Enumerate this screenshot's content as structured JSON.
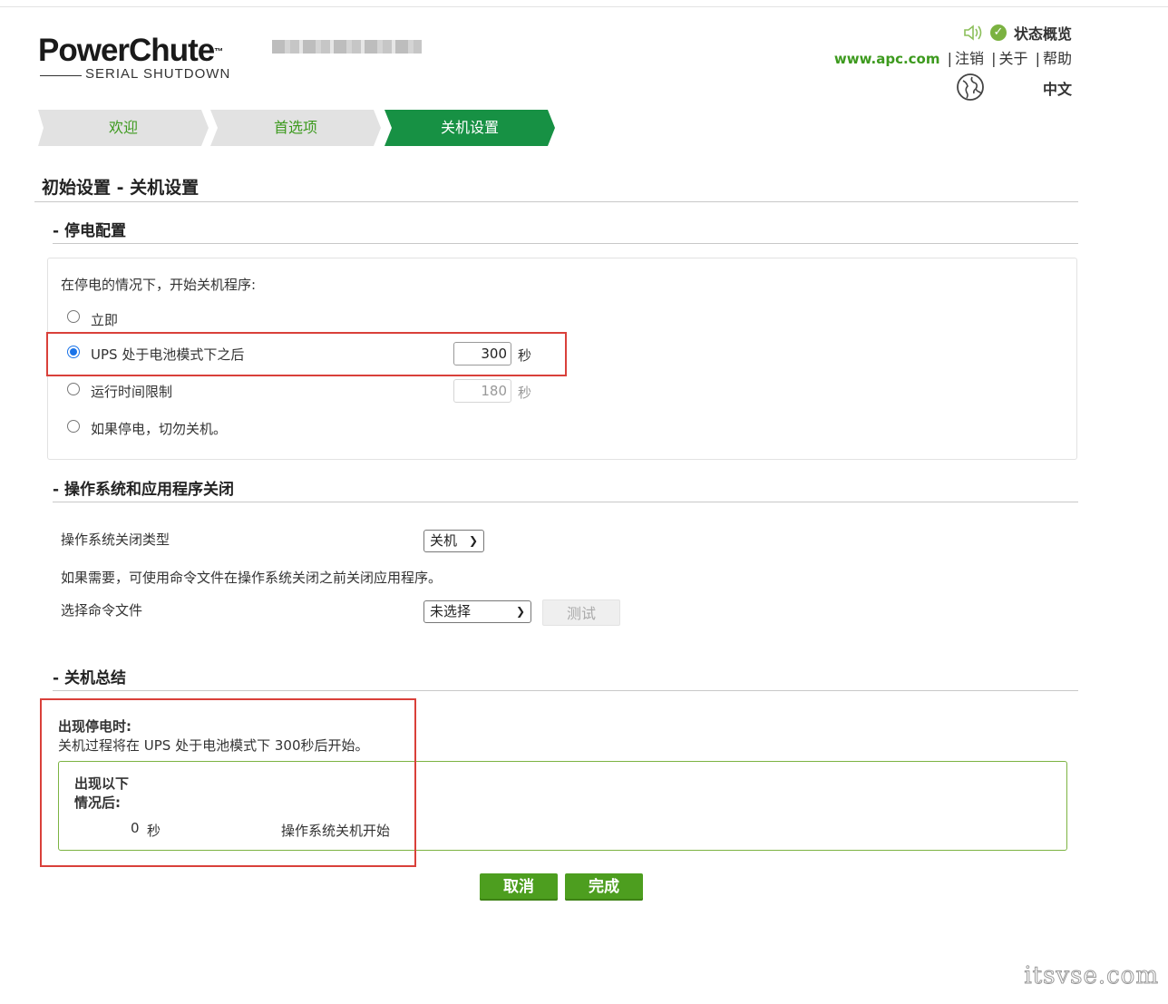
{
  "logo": {
    "main": "PowerChute",
    "tm": "™",
    "sub": "SERIAL SHUTDOWN"
  },
  "header": {
    "status_label": "状态概览",
    "apc_link": "www.apc.com",
    "logout": "注销",
    "about": "关于",
    "help": "帮助",
    "language": "中文",
    "separator": "|"
  },
  "steps": [
    "欢迎",
    "首选项",
    "关机设置"
  ],
  "page_title": "初始设置 - 关机设置",
  "power_section": {
    "heading": "- 停电配置",
    "prompt": "在停电的情况下，开始关机程序:",
    "options": [
      {
        "label": "立即",
        "checked": false
      },
      {
        "label": "UPS 处于电池模式下之后",
        "checked": true,
        "value": "300",
        "unit": "秒"
      },
      {
        "label": "运行时间限制",
        "checked": false,
        "value": "180",
        "unit": "秒"
      },
      {
        "label": "如果停电，切勿关机。",
        "checked": false
      }
    ]
  },
  "os_section": {
    "heading": "- 操作系统和应用程序关闭",
    "shutdown_type_label": "操作系统关闭类型",
    "shutdown_type_value": "关机",
    "note": "如果需要，可使用命令文件在操作系统关闭之前关闭应用程序。",
    "command_file_label": "选择命令文件",
    "command_file_value": "未选择",
    "test_button": "测试"
  },
  "summary_section": {
    "heading": "- 关机总结",
    "title": "出现停电时:",
    "description": "关机过程将在 UPS 处于电池模式下 300秒后开始。",
    "after_label_1": "出现以下",
    "after_label_2": "情况后:",
    "seconds": "0",
    "seconds_unit": "秒",
    "event": "操作系统关机开始"
  },
  "buttons": {
    "cancel": "取消",
    "finish": "完成"
  },
  "watermark": "itsvse.com",
  "colors": {
    "brand_green": "#179144",
    "link_green": "#3d9a1e",
    "button_green": "#4d9e1f",
    "highlight_red": "#d9403a"
  }
}
